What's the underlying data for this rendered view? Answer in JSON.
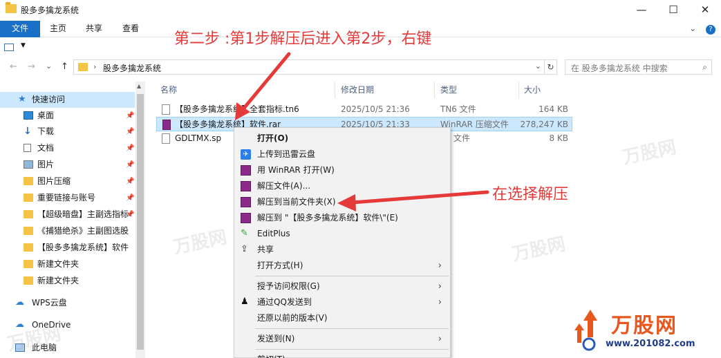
{
  "window": {
    "title": "股多多擒龙系统",
    "minimize": "—",
    "maximize": "☐",
    "close": "✕"
  },
  "ribbon": {
    "tabs": [
      "文件",
      "主页",
      "共享",
      "查看"
    ],
    "expand": "⌄",
    "help": "?"
  },
  "address": {
    "back": "←",
    "forward": "→",
    "recent": "⌄",
    "up": "↑",
    "separator": "›",
    "path": "股多多擒龙系统",
    "refresh": "↻",
    "search_placeholder": "在 股多多擒龙系统 中搜索"
  },
  "sidebar": {
    "quick_access": "快速访问",
    "items": [
      {
        "label": "桌面",
        "pinned": true
      },
      {
        "label": "下载",
        "pinned": true
      },
      {
        "label": "文档",
        "pinned": true
      },
      {
        "label": "图片",
        "pinned": true
      },
      {
        "label": "图片压缩",
        "pinned": true
      },
      {
        "label": "重要链接与账号",
        "pinned": true
      },
      {
        "label": "【超级暗盘】主副选指标",
        "pinned": true
      },
      {
        "label": "《捕猎绝杀》主副图选股",
        "pinned": false
      },
      {
        "label": "【股多多擒龙系统】软件",
        "pinned": false
      },
      {
        "label": "新建文件夹",
        "pinned": false
      },
      {
        "label": "新建文件夹",
        "pinned": false
      }
    ],
    "wps": "WPS云盘",
    "onedrive": "OneDrive",
    "pc": "此电脑"
  },
  "columns": {
    "name": "名称",
    "modified": "修改日期",
    "type": "类型",
    "size": "大小"
  },
  "files": [
    {
      "name": "【股多多擒龙系统】全套指标.tn6",
      "modified": "2025/10/5 21:36",
      "type": "TN6 文件",
      "size": "164 KB"
    },
    {
      "name": "【股多多擒龙系统】软件.rar",
      "modified": "2025/10/5 21:33",
      "type": "WinRAR 压缩文件",
      "size": "278,247 KB"
    },
    {
      "name": "GDLTMX.sp",
      "modified": "",
      "type": "文件",
      "size": "8 KB"
    }
  ],
  "context_menu": [
    {
      "label": "打开(O)",
      "bold": true
    },
    {
      "label": "上传到迅雷云盘",
      "icon": "xunlei-icon"
    },
    {
      "label": "用 WinRAR 打开(W)",
      "icon": "winrar-icon"
    },
    {
      "label": "解压文件(A)...",
      "icon": "winrar-icon"
    },
    {
      "label": "解压到当前文件夹(X)",
      "icon": "winrar-icon"
    },
    {
      "label": "解压到 \"【股多多擒龙系统】软件\\\"(E)",
      "icon": "winrar-icon"
    },
    {
      "label": "EditPlus",
      "icon": "editplus-icon"
    },
    {
      "label": "共享",
      "icon": "share-icon"
    },
    {
      "label": "打开方式(H)",
      "submenu": true
    },
    {
      "label": "授予访问权限(G)",
      "submenu": true
    },
    {
      "label": "通过QQ发送到",
      "icon": "qq-icon",
      "submenu": true
    },
    {
      "label": "还原以前的版本(V)"
    },
    {
      "label": "发送到(N)",
      "submenu": true
    },
    {
      "label": "剪切(T)"
    }
  ],
  "annotations": {
    "step2": "第二步 :第1步解压后进入第2步，右键",
    "choose": "在选择解压"
  },
  "watermark": {
    "brand": "万股网",
    "url": "www.201082.com"
  },
  "colors": {
    "accent": "#1a6fc6",
    "selection": "#cce8ff",
    "annotation": "#e53a3a"
  }
}
